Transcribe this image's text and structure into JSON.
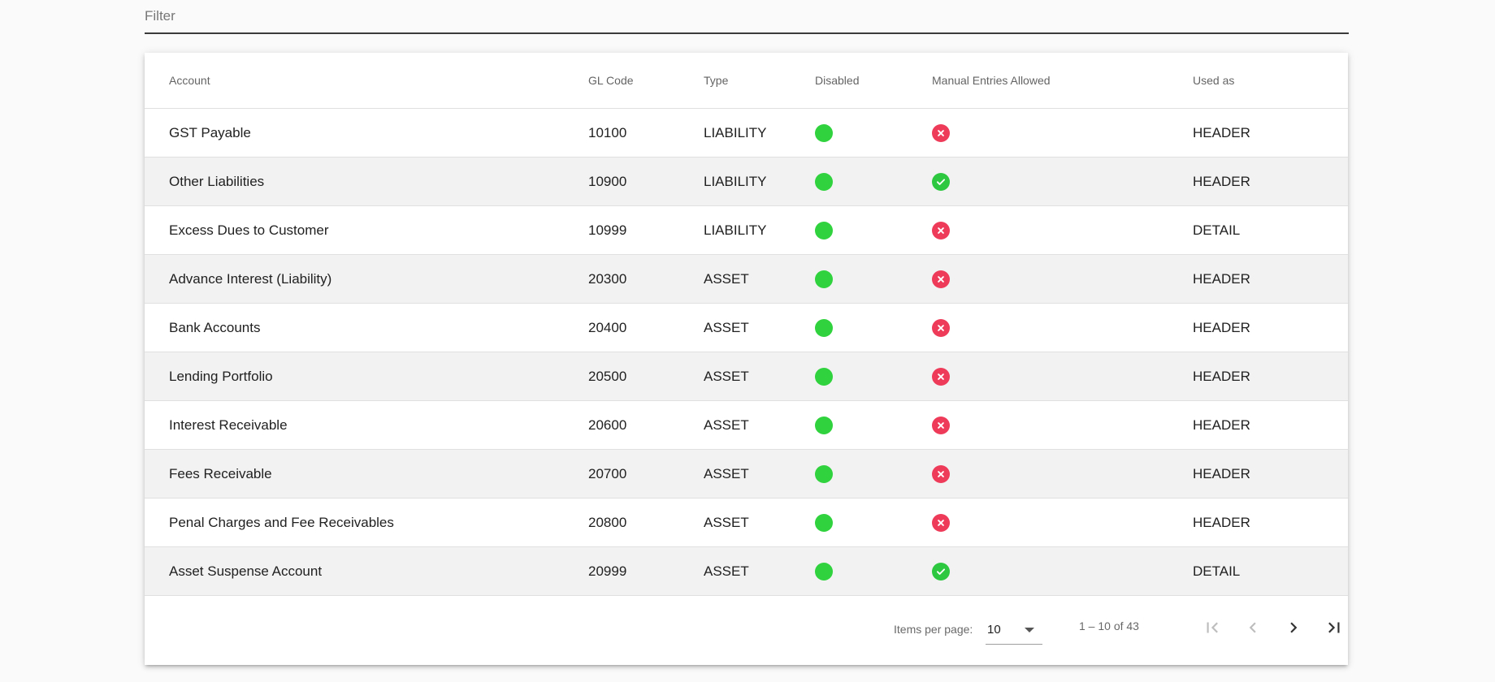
{
  "filter": {
    "placeholder": "Filter",
    "value": ""
  },
  "table": {
    "headers": {
      "account": "Account",
      "gl_code": "GL Code",
      "type": "Type",
      "disabled": "Disabled",
      "manual": "Manual Entries Allowed",
      "used_as": "Used as"
    },
    "rows": [
      {
        "account": "GST Payable",
        "gl_code": "10100",
        "type": "LIABILITY",
        "disabled": true,
        "manual": false,
        "used_as": "HEADER"
      },
      {
        "account": "Other Liabilities",
        "gl_code": "10900",
        "type": "LIABILITY",
        "disabled": true,
        "manual": true,
        "used_as": "HEADER"
      },
      {
        "account": "Excess Dues to Customer",
        "gl_code": "10999",
        "type": "LIABILITY",
        "disabled": true,
        "manual": false,
        "used_as": "DETAIL"
      },
      {
        "account": "Advance Interest (Liability)",
        "gl_code": "20300",
        "type": "ASSET",
        "disabled": true,
        "manual": false,
        "used_as": "HEADER"
      },
      {
        "account": "Bank Accounts",
        "gl_code": "20400",
        "type": "ASSET",
        "disabled": true,
        "manual": false,
        "used_as": "HEADER"
      },
      {
        "account": "Lending Portfolio",
        "gl_code": "20500",
        "type": "ASSET",
        "disabled": true,
        "manual": false,
        "used_as": "HEADER"
      },
      {
        "account": "Interest Receivable",
        "gl_code": "20600",
        "type": "ASSET",
        "disabled": true,
        "manual": false,
        "used_as": "HEADER"
      },
      {
        "account": "Fees Receivable",
        "gl_code": "20700",
        "type": "ASSET",
        "disabled": true,
        "manual": false,
        "used_as": "HEADER"
      },
      {
        "account": "Penal Charges and Fee Receivables",
        "gl_code": "20800",
        "type": "ASSET",
        "disabled": true,
        "manual": false,
        "used_as": "HEADER"
      },
      {
        "account": "Asset Suspense Account",
        "gl_code": "20999",
        "type": "ASSET",
        "disabled": true,
        "manual": true,
        "used_as": "DETAIL"
      }
    ]
  },
  "paginator": {
    "items_per_page_label": "Items per page:",
    "items_per_page_value": "10",
    "range_label": "1 – 10 of 43",
    "buttons": [
      "first-page-icon",
      "previous-page-icon",
      "next-page-icon",
      "last-page-icon"
    ]
  },
  "colors": {
    "disabled_dot": "#30d33e",
    "manual_yes": "#2ec840",
    "manual_no": "#ef3b5a",
    "row_stripe": "#f2f2f2"
  }
}
